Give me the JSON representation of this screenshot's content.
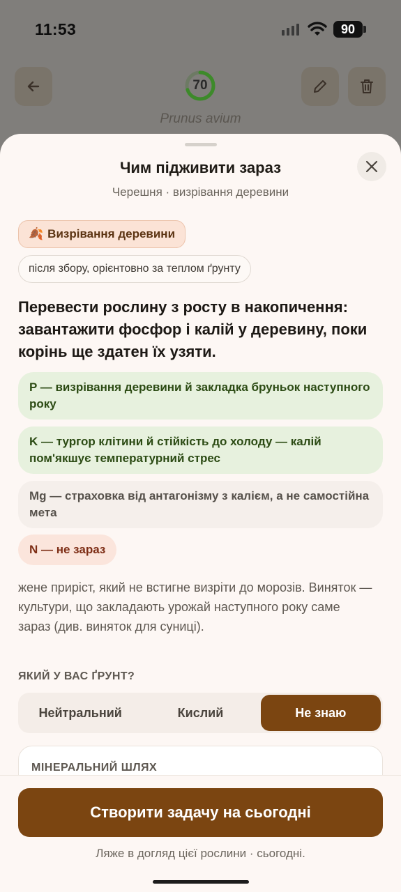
{
  "status_bar": {
    "time": "11:53",
    "battery": "90"
  },
  "background": {
    "progress_score": "70",
    "latin_name": "Prunus avium",
    "progress_fraction": 0.7
  },
  "sheet": {
    "title": "Чим підживити зараз",
    "subtitle": "Черешня · визрівання деревини",
    "stage_chip": {
      "icon": "leaf-icon",
      "emoji": "🍂",
      "label": "Визрівання деревини"
    },
    "timing_note": "після збору, орієнтовно за теплом ґрунту",
    "lead": "Перевести рослину з росту в накопичення: завантажити фосфор і калій у деревину, поки корінь ще здатен їх узяти.",
    "nutrients": [
      {
        "text": "P — визрівання деревини й закладка бруньок наступного року",
        "tone": "green"
      },
      {
        "text": "K — тургор клітини й стійкість до холоду — калій пом'якшує температурний стрес",
        "tone": "green"
      },
      {
        "text": "Mg — страховка від антагонізму з калієм, а не самостійна мета",
        "tone": "gray"
      },
      {
        "text": "N — не зараз",
        "tone": "red"
      }
    ],
    "explanation": "жене приріст, який не встигне визріти до морозів. Виняток — культури, що закладають урожай наступного року саме зараз (див. виняток для суниці).",
    "soil_question": "ЯКИЙ У ВАС ҐРУНТ?",
    "soil_options": [
      "Нейтральний",
      "Кислий",
      "Не знаю"
    ],
    "soil_selected": "Не знаю",
    "mineral_card_label": "МІНЕРАЛЬНИЙ ШЛЯХ",
    "cta_label": "Створити задачу на сьогодні",
    "cta_hint": "Ляже в догляд цієї рослини · сьогодні."
  },
  "colors": {
    "accent": "#7b4511",
    "green_chip": "#e7f1de",
    "red_chip": "#fbe5dc",
    "ring_green": "#3d8a2a"
  }
}
